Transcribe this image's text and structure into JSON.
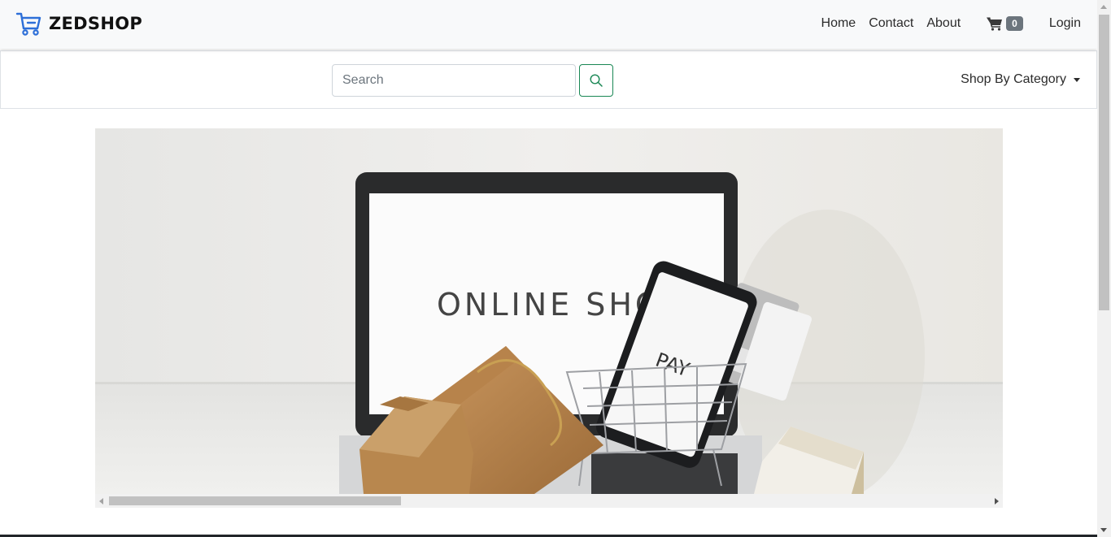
{
  "brand": {
    "name": "ZEDSHOP",
    "icon": "shopping-cart-icon",
    "color": "#2d6fd8"
  },
  "nav": {
    "links": [
      "Home",
      "Contact",
      "About"
    ],
    "cart_count": "0",
    "login": "Login"
  },
  "search": {
    "placeholder": "Search",
    "value": "",
    "button_icon": "search-icon",
    "button_color": "#198754"
  },
  "category_menu": {
    "label": "Shop By Category"
  },
  "hero": {
    "screen_text": "ONLINE SHOPPING",
    "phone_text": "PAY"
  }
}
